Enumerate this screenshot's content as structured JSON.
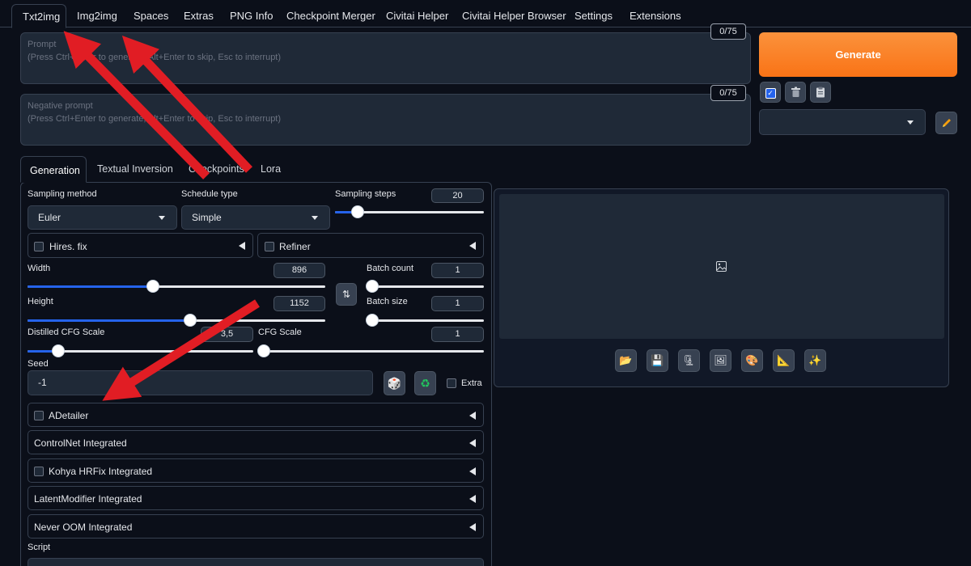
{
  "top_tabs": [
    "Txt2img",
    "Img2img",
    "Spaces",
    "Extras",
    "PNG Info",
    "Checkpoint Merger",
    "Civitai Helper",
    "Civitai Helper Browser",
    "Settings",
    "Extensions"
  ],
  "prompt": {
    "label": "Prompt",
    "placeholder": "(Press Ctrl+Enter to generate, Alt+Enter to skip, Esc to interrupt)",
    "counter": "0/75"
  },
  "negative_prompt": {
    "label": "Negative prompt",
    "placeholder": "(Press Ctrl+Enter to generate, Alt+Enter to skip, Esc to interrupt)",
    "counter": "0/75"
  },
  "generate_label": "Generate",
  "sub_tabs": [
    "Generation",
    "Textual Inversion",
    "Checkpoints",
    "Lora"
  ],
  "sampling": {
    "method_label": "Sampling method",
    "method_value": "Euler",
    "schedule_label": "Schedule type",
    "schedule_value": "Simple",
    "steps_label": "Sampling steps",
    "steps_value": "20"
  },
  "hires_fix_label": "Hires. fix",
  "refiner_label": "Refiner",
  "width": {
    "label": "Width",
    "value": "896"
  },
  "height": {
    "label": "Height",
    "value": "1152"
  },
  "batch_count": {
    "label": "Batch count",
    "value": "1"
  },
  "batch_size": {
    "label": "Batch size",
    "value": "1"
  },
  "distilled_cfg": {
    "label": "Distilled CFG Scale",
    "value": "3,5"
  },
  "cfg": {
    "label": "CFG Scale",
    "value": "1"
  },
  "seed": {
    "label": "Seed",
    "value": "-1",
    "extra_label": "Extra"
  },
  "accordions": {
    "adetailer": "ADetailer",
    "controlnet": "ControlNet Integrated",
    "kohya": "Kohya HRFix Integrated",
    "latent": "LatentModifier Integrated",
    "never_oom": "Never OOM Integrated"
  },
  "script_label": "Script",
  "colors": {
    "background": "#0b0f19",
    "panel": "#1f2937",
    "border": "#374151",
    "accent_orange": "#f97316",
    "slider_blue": "#2563eb",
    "annotation_red": "#e11d24"
  },
  "icons": [
    "image-placeholder-icon",
    "folder-icon",
    "save-icon",
    "zip-icon",
    "send-to-img2img-icon",
    "send-to-inpaint-icon",
    "send-to-extras-icon",
    "sparkle-icon",
    "trash-icon",
    "clipboard-icon",
    "pencil-icon",
    "dice-icon",
    "recycle-icon",
    "swap-icon"
  ]
}
